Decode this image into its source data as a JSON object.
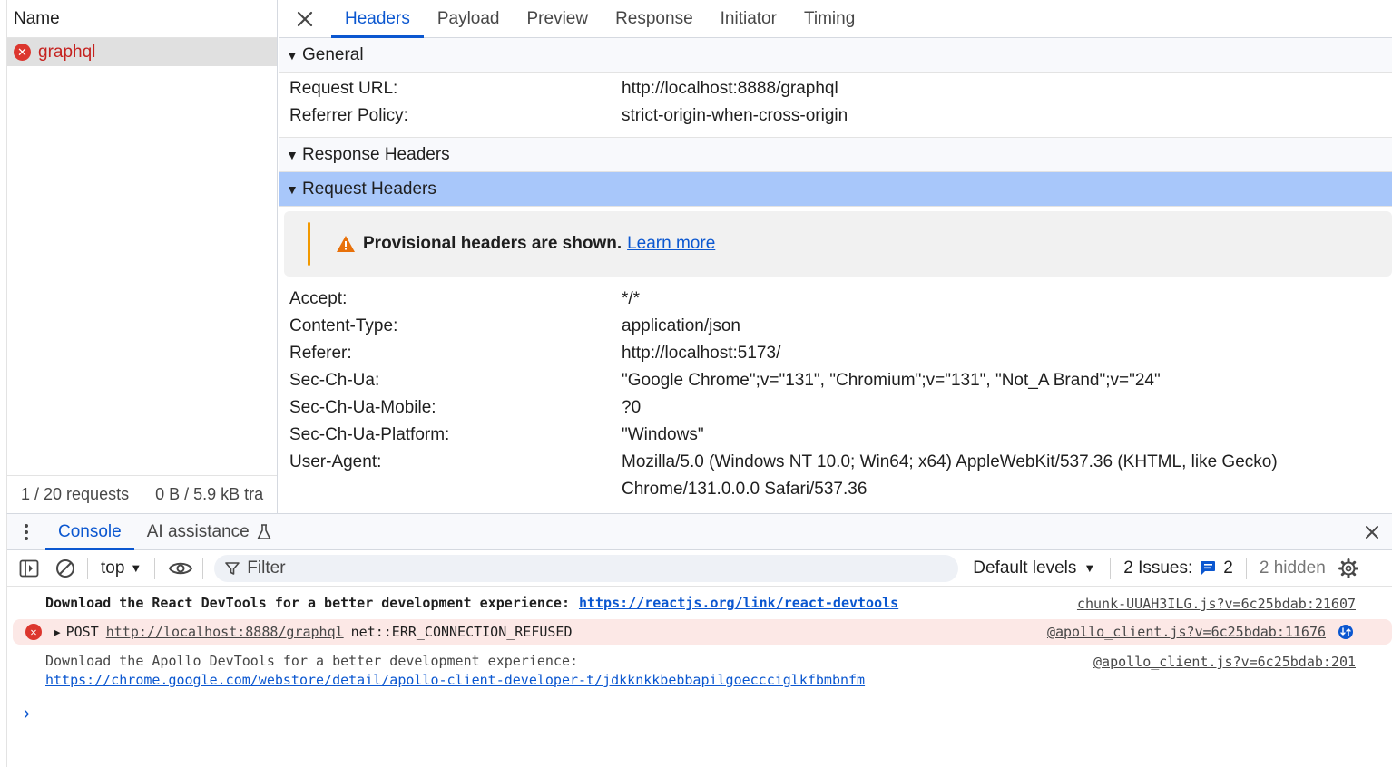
{
  "request_list": {
    "header": "Name",
    "requests": [
      {
        "name": "graphql",
        "status": "error"
      }
    ],
    "footer": {
      "count": "1 / 20 requests",
      "transferred": "0 B / 5.9 kB tra"
    }
  },
  "detail_tabs": [
    "Headers",
    "Payload",
    "Preview",
    "Response",
    "Initiator",
    "Timing"
  ],
  "active_tab": "Headers",
  "general": {
    "title": "General",
    "rows": [
      {
        "key": "Request URL:",
        "value": "http://localhost:8888/graphql"
      },
      {
        "key": "Referrer Policy:",
        "value": "strict-origin-when-cross-origin"
      }
    ]
  },
  "response_headers": {
    "title": "Response Headers"
  },
  "request_headers": {
    "title": "Request Headers",
    "warning": {
      "text": "Provisional headers are shown.",
      "link": "Learn more"
    },
    "rows": [
      {
        "key": "Accept:",
        "value": "*/*"
      },
      {
        "key": "Content-Type:",
        "value": "application/json"
      },
      {
        "key": "Referer:",
        "value": "http://localhost:5173/"
      },
      {
        "key": "Sec-Ch-Ua:",
        "value": "\"Google Chrome\";v=\"131\", \"Chromium\";v=\"131\", \"Not_A Brand\";v=\"24\""
      },
      {
        "key": "Sec-Ch-Ua-Mobile:",
        "value": "?0"
      },
      {
        "key": "Sec-Ch-Ua-Platform:",
        "value": "\"Windows\""
      },
      {
        "key": "User-Agent:",
        "value": "Mozilla/5.0 (Windows NT 10.0; Win64; x64) AppleWebKit/537.36 (KHTML, like Gecko)"
      }
    ],
    "user_agent_continued": "Chrome/131.0.0.0 Safari/537.36"
  },
  "drawer": {
    "tabs": [
      {
        "label": "Console",
        "active": true
      },
      {
        "label": "AI assistance",
        "active": false
      }
    ]
  },
  "console_toolbar": {
    "context": "top",
    "filter_placeholder": "Filter",
    "levels": "Default levels",
    "issues_label": "2 Issues:",
    "issues_count": "2",
    "hidden": "2 hidden"
  },
  "console": {
    "messages": [
      {
        "text": "Download the React DevTools for a better development experience:",
        "link": "https://reactjs.org/link/react-devtools",
        "source": "chunk-UUAH3ILG.js?v=6c25bdab:21607"
      },
      {
        "method": "POST",
        "url": "http://localhost:8888/graphql",
        "error": "net::ERR_CONNECTION_REFUSED",
        "source": "@apollo_client.js?v=6c25bdab:11676"
      },
      {
        "text": "Download the Apollo DevTools for a better development experience:",
        "link": "https://chrome.google.com/webstore/detail/apollo-client-developer-t/jdkknkkbebbapilgoeccciglkfbmbnfm",
        "source": "@apollo_client.js?v=6c25bdab:201"
      }
    ]
  },
  "colors": {
    "accent": "#0b57d0",
    "error": "#dc362e",
    "error_bg": "#fce8e6",
    "selected_section": "#a8c7fa",
    "warning": "#f29900"
  }
}
